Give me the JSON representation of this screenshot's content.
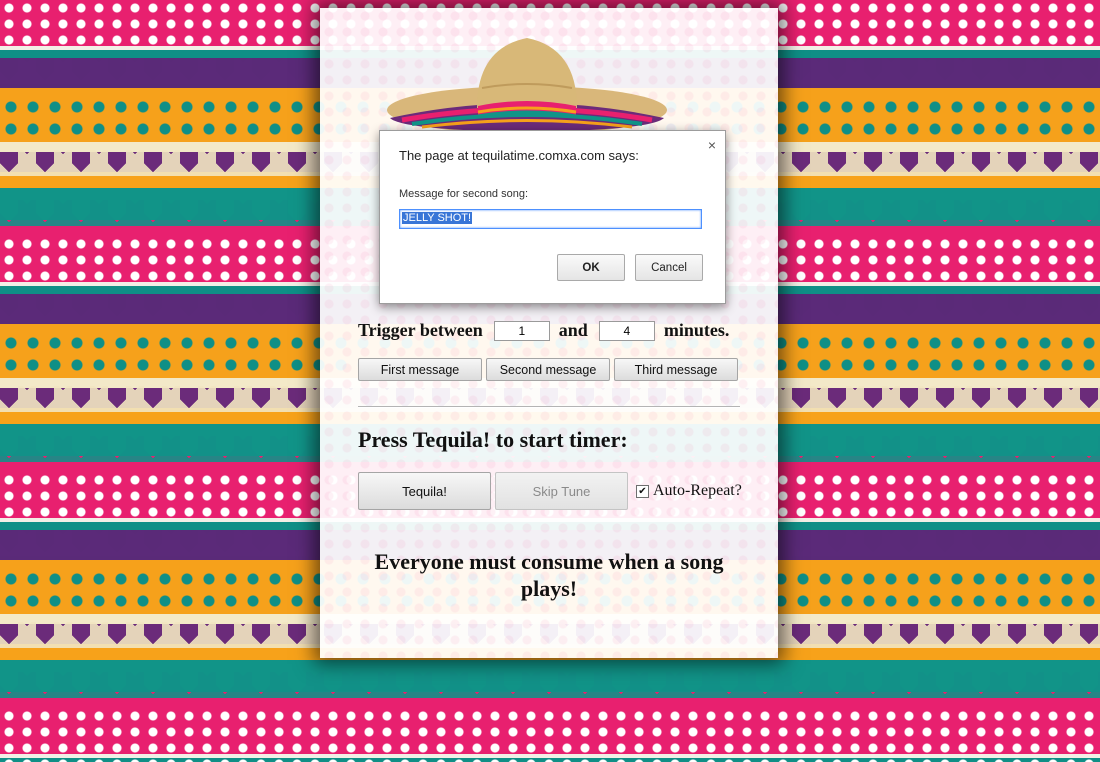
{
  "dialog": {
    "title": "The page at tequilatime.comxa.com says:",
    "close_symbol": "×",
    "prompt_label": "Message for second song:",
    "input_value": "JELLY SHOT!",
    "ok_label": "OK",
    "cancel_label": "Cancel"
  },
  "trigger": {
    "label_prefix": "Trigger between",
    "min_value": "1",
    "label_and": "and",
    "max_value": "4",
    "label_suffix": "minutes."
  },
  "message_buttons": [
    {
      "label": "First message"
    },
    {
      "label": "Second message"
    },
    {
      "label": "Third message"
    }
  ],
  "press_title": "Press Tequila! to start timer:",
  "controls": {
    "tequila_label": "Tequila!",
    "skip_label": "Skip Tune",
    "autorepeat_label": "Auto-Repeat?",
    "autorepeat_checked": true
  },
  "consume_text": "Everyone must consume when a song plays!",
  "colors": {
    "pink": "#e8206f",
    "orange": "#f6a11b",
    "teal": "#0f8f86",
    "purple": "#5a2a78",
    "cream": "#f2e6c2"
  },
  "icons": {
    "hat": "sombrero-image",
    "check": "checkbox-checked-icon",
    "close": "close-icon"
  }
}
